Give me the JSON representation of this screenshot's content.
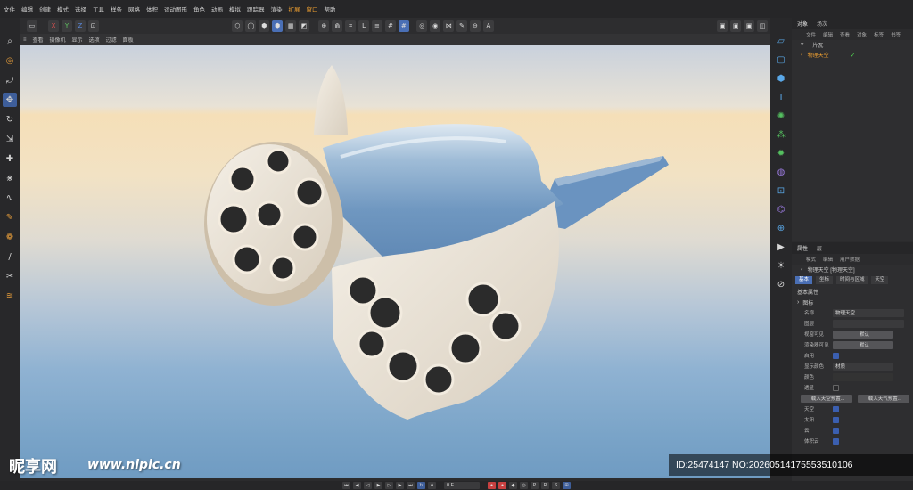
{
  "menubar": {
    "items": [
      "文件",
      "编辑",
      "创建",
      "模式",
      "选择",
      "工具",
      "样条",
      "网格",
      "体积",
      "运动图形",
      "角色",
      "动画",
      "模拟",
      "跟踪器",
      "渲染",
      "扩展",
      "窗口",
      "帮助"
    ],
    "highlight_color": "#f0a030"
  },
  "toolbar": {
    "axes": [
      "X",
      "Y",
      "Z"
    ]
  },
  "viewport_menu": {
    "items": [
      "查看",
      "摄像机",
      "显示",
      "选项",
      "过滤",
      "面板"
    ]
  },
  "object_manager": {
    "tabs": [
      "对象",
      "场次"
    ],
    "menu": [
      "文件",
      "编辑",
      "查看",
      "对象",
      "标签",
      "书签"
    ],
    "objects": [
      {
        "name": "一片瓦",
        "selected": false
      },
      {
        "name": "物理天空",
        "selected": true
      }
    ]
  },
  "attributes": {
    "tabs": [
      "属性",
      "层"
    ],
    "menu": [
      "模式",
      "编辑",
      "用户数据"
    ],
    "object_title": "物理天空 [物理天空]",
    "subtabs": [
      "基本",
      "坐标",
      "时间与区域",
      "天空"
    ],
    "section": "基本属性",
    "group": "图标",
    "fields": [
      {
        "label": "名称",
        "value": "物理天空"
      },
      {
        "label": "图层",
        "value": ""
      },
      {
        "label": "视窗可见",
        "value": "默认"
      },
      {
        "label": "渲染器可见",
        "value": "默认"
      },
      {
        "label": "启用",
        "value": ""
      },
      {
        "label": "显示颜色",
        "value": "材质"
      },
      {
        "label": "颜色",
        "value": ""
      },
      {
        "label": "透显",
        "value": ""
      }
    ],
    "buttons": [
      "载入天空预置...",
      "载入天气预置..."
    ],
    "sky_rows": [
      "天空",
      "太阳",
      "云",
      "体积云"
    ]
  },
  "timeline": {
    "frame": "0 F"
  },
  "watermark": {
    "logo_text": "昵享网",
    "url": "www.nipic.cn",
    "id_text": "ID:25474147 NO:20260514175553510106"
  },
  "colors": {
    "accent": "#4a6fb5",
    "sky_tile": "#6f9bc2",
    "ornament": "#efe6d6"
  }
}
